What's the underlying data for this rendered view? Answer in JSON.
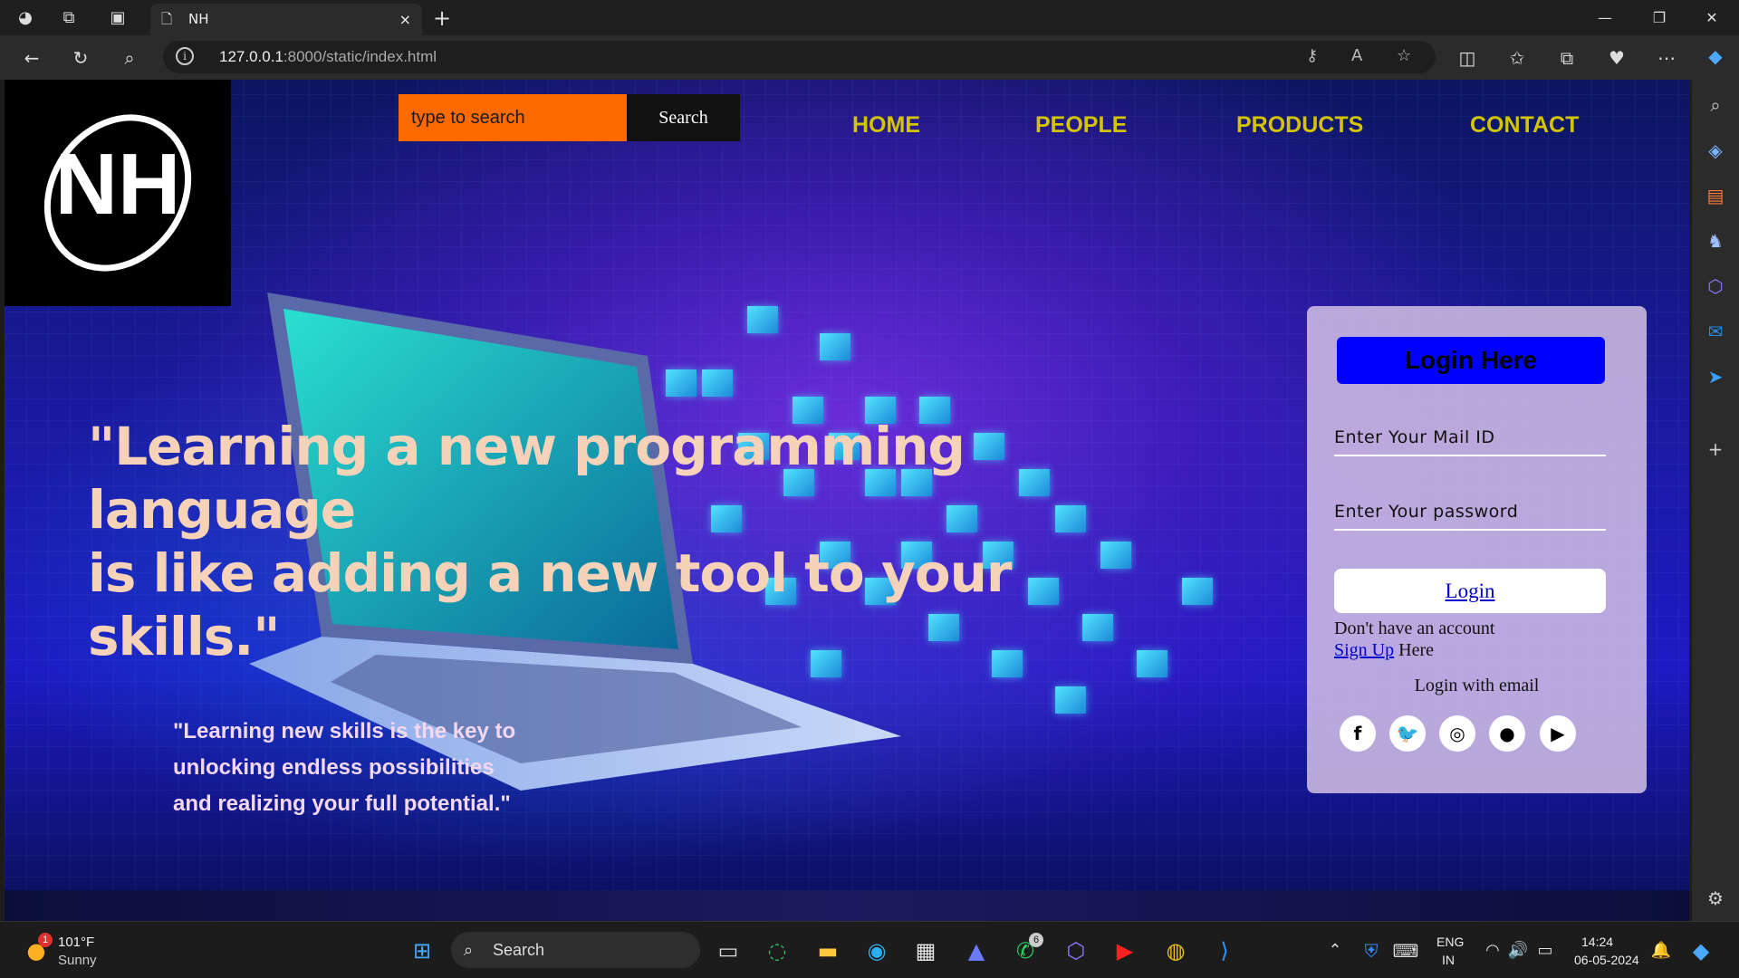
{
  "browser": {
    "tab_title": "NH",
    "url_host": "127.0.0.1",
    "url_path": ":8000/static/index.html",
    "new_tab": "+",
    "close_tab": "×"
  },
  "site": {
    "logo_text": "NH",
    "search": {
      "placeholder": "type to search",
      "button": "Search"
    },
    "nav": [
      "HOME",
      "PEOPLE",
      "PRODUCTS",
      "CONTACT"
    ],
    "quote_main_line1": "\"Learning a new programming language",
    "quote_main_line2": "is like adding a new tool to your skills.\"",
    "quote_sub_line1": "\"Learning new skills is the key to",
    "quote_sub_line2": "unlocking endless possibilities",
    "quote_sub_line3": "and realizing your full potential.\"",
    "login": {
      "title": "Login Here",
      "mail_placeholder": "Enter Your Mail ID",
      "password_placeholder": "Enter Your password",
      "button": "Login",
      "no_account": "Don't have an account",
      "signup_link": "Sign Up",
      "signup_suffix": " Here",
      "login_with": "Login with email",
      "socials": [
        "facebook-icon",
        "twitter-icon",
        "instagram-icon",
        "github-icon",
        "youtube-icon"
      ]
    }
  },
  "taskbar": {
    "weather_temp": "101°F",
    "weather_desc": "Sunny",
    "weather_badge": "1",
    "search_label": "Search",
    "whatsapp_badge": "6",
    "lang_line1": "ENG",
    "lang_line2": "IN",
    "time": "14:24",
    "date": "06-05-2024"
  },
  "colors": {
    "nav_link": "#d4c400",
    "search_bg": "#ff6a00",
    "login_title_bg": "#0000ff",
    "quote_main": "#f6d3b8"
  }
}
